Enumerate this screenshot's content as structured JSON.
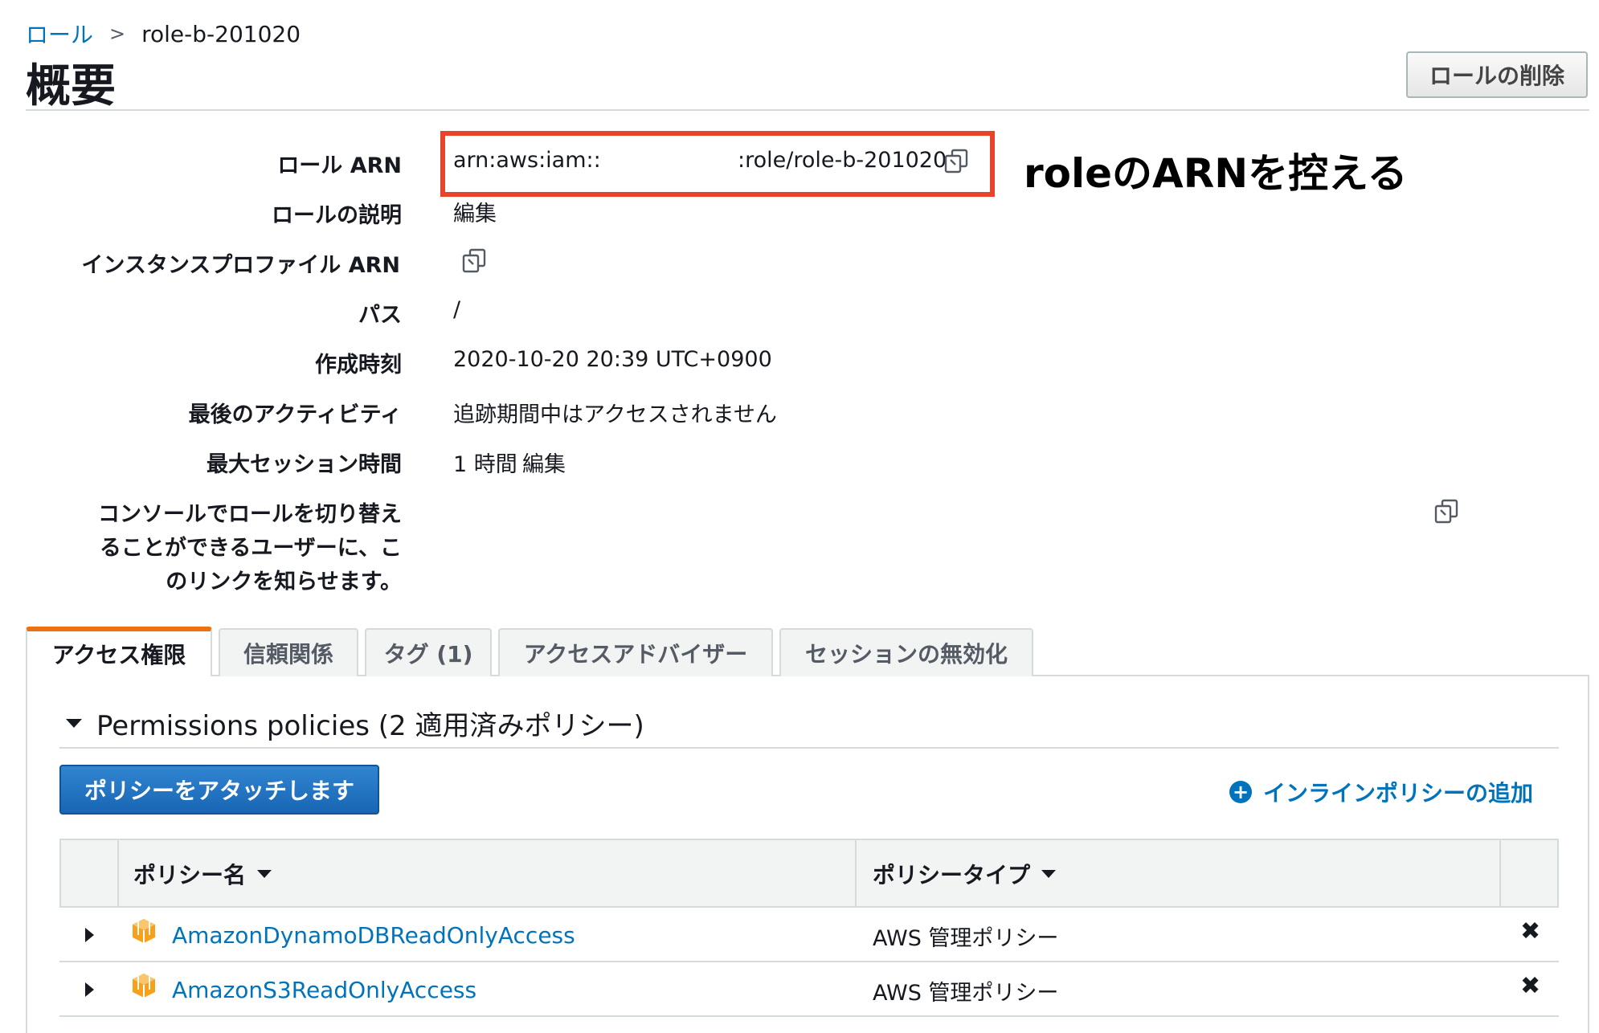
{
  "breadcrumb": {
    "parent": "ロール",
    "current": "role-b-201020"
  },
  "page": {
    "title": "概要",
    "delete_button": "ロールの削除"
  },
  "details": {
    "role_arn_label": "ロール ARN",
    "role_arn_prefix": "arn:aws:iam::",
    "role_arn_suffix": ":role/role-b-201020",
    "role_desc_label": "ロールの説明",
    "role_desc_edit": "編集",
    "instance_profile_label": "インスタンスプロファイル ARN",
    "path_label": "パス",
    "path_value": "/",
    "created_label": "作成時刻",
    "created_value": "2020-10-20 20:39 UTC+0900",
    "last_activity_label": "最後のアクティビティ",
    "last_activity_value": "追跡期間中はアクセスされません",
    "max_session_label": "最大セッション時間",
    "max_session_value": "1 時間",
    "max_session_edit": "編集",
    "switch_link_label_1": "コンソールでロールを切り替え",
    "switch_link_label_2": "ることができるユーザーに、こ",
    "switch_link_label_3": "のリンクを知らせます。"
  },
  "annotation": "roleのARNを控える",
  "tabs": [
    "アクセス権限",
    "信頼関係",
    "タグ (1)",
    "アクセスアドバイザー",
    "セッションの無効化"
  ],
  "permissions": {
    "section_title": "Permissions policies (2 適用済みポリシー)",
    "attach_button": "ポリシーをアタッチします",
    "inline_add": "インラインポリシーの追加",
    "col_name": "ポリシー名",
    "col_type": "ポリシータイプ",
    "rows": [
      {
        "name": "AmazonDynamoDBReadOnlyAccess",
        "type": "AWS 管理ポリシー"
      },
      {
        "name": "AmazonS3ReadOnlyAccess",
        "type": "AWS 管理ポリシー"
      }
    ],
    "remove_glyph": "✖"
  },
  "colors": {
    "link": "#0073bb",
    "accent_tab": "#ec7211",
    "highlight_box": "#e8432b",
    "primary_button": "#1866b4"
  }
}
